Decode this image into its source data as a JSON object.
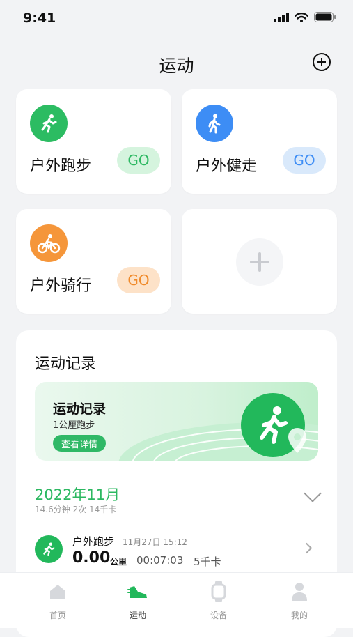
{
  "status_bar": {
    "time": "9:41"
  },
  "header": {
    "title": "运动"
  },
  "sports": [
    {
      "label": "户外跑步",
      "go": "GO",
      "icon": "runner-icon",
      "color": "#2cbc62",
      "go_bg": "#d5f4de",
      "go_color": "#2cb861"
    },
    {
      "label": "户外健走",
      "go": "GO",
      "icon": "walker-icon",
      "color": "#3d8df5",
      "go_bg": "#d9e9fb",
      "go_color": "#3d8df5"
    },
    {
      "label": "户外骑行",
      "go": "GO",
      "icon": "cyclist-icon",
      "color": "#f5963a",
      "go_bg": "#fde2c8",
      "go_color": "#f08a2a"
    }
  ],
  "records": {
    "title": "运动记录",
    "banner": {
      "title": "运动记录",
      "subtitle": "1公厘跑步",
      "button": "查看详情"
    },
    "month": "2022年11月",
    "month_stats": "14.6分钟  2次  14千卡",
    "item": {
      "name": "户外跑步",
      "date": "11月27日  15:12",
      "value": "0.00",
      "unit": "公里",
      "duration": "00:07:03",
      "calories": "5千卡"
    }
  },
  "tabs": [
    {
      "label": "首页",
      "icon": "home-icon"
    },
    {
      "label": "运动",
      "icon": "shoe-icon",
      "active": true
    },
    {
      "label": "设备",
      "icon": "watch-icon"
    },
    {
      "label": "我的",
      "icon": "person-icon"
    }
  ]
}
